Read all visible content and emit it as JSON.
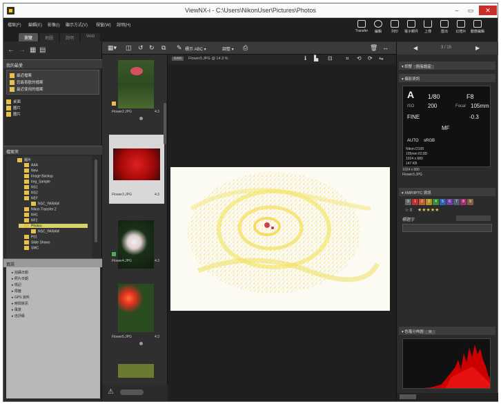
{
  "window": {
    "title": "ViewNX-i - C:\\Users\\NikonUser\\Pictures\\Photos",
    "controls": {
      "minimize": "–",
      "maximize": "▭",
      "close": "✕"
    }
  },
  "menu": [
    "檔案(F)",
    "編輯(E)",
    "影像(I)",
    "顯示方式(V)",
    "視窗(W)",
    "說明(H)"
  ],
  "workspaces": [
    "瀏覽",
    "地圖",
    "說明",
    "Web"
  ],
  "toolbar": [
    "Transfer",
    "編輯",
    "列印",
    "電子郵件",
    "上傳",
    "匯出",
    "幻燈片",
    "動態編輯"
  ],
  "left_panel": {
    "favorites_title": "我的最愛",
    "favorites": [
      "最近檔案",
      "您最喜歡的檔案",
      "最近使用的檔案"
    ],
    "locations": [
      "桌面",
      "圖片",
      "圖片"
    ],
    "tree_title": "檔案夾",
    "tree": [
      {
        "label": "圖片",
        "level": 0
      },
      {
        "label": "AAA",
        "level": 1
      },
      {
        "label": "New",
        "level": 1
      },
      {
        "label": "Image Backup",
        "level": 1
      },
      {
        "label": "Img_Sample",
        "level": 1
      },
      {
        "label": "NS1",
        "level": 1
      },
      {
        "label": "NS2",
        "level": 1
      },
      {
        "label": "NEF",
        "level": 1
      },
      {
        "label": "NSC_PARAM",
        "level": 2
      },
      {
        "label": "Nikon Transfer 2",
        "level": 1
      },
      {
        "label": "NH1",
        "level": 1
      },
      {
        "label": "NF2",
        "level": 1
      },
      {
        "label": "Photos",
        "level": 1,
        "selected": true
      },
      {
        "label": "NSC_PARAM",
        "level": 2
      },
      {
        "label": "P01",
        "level": 1
      },
      {
        "label": "Slide Shows",
        "level": 1
      },
      {
        "label": "SMC",
        "level": 1
      }
    ],
    "meta_title": "資訊",
    "meta_items": [
      "拍攝日期",
      "照片日期",
      "標記",
      "標籤",
      "GPS 資料",
      "時間資訊",
      "風景",
      "自評級"
    ]
  },
  "thumbnails": [
    {
      "name": "Flower2.JPG",
      "ext": "4:3",
      "selected": false
    },
    {
      "name": "Flower3.JPG",
      "ext": "4:3",
      "selected": true
    },
    {
      "name": "Flower4.JPG",
      "ext": "4:3",
      "selected": false
    },
    {
      "name": "Flower5.JPG",
      "ext": "4:3",
      "selected": false
    }
  ],
  "viewer": {
    "toolbar_text": "標示 ABC",
    "toolbar_menu": "調整",
    "info_label": "Flower3.JPG @ 14.3 %"
  },
  "right_panel": {
    "counter": "3 / 15",
    "tab_label": "調整",
    "preset": "所有設定",
    "section_info": "攝影資訊",
    "camera": {
      "mode": "A",
      "shutter": "1/80",
      "aperture": "F8",
      "iso_label": "ISO",
      "iso": "200",
      "focal_label": "Focal",
      "focal": "105mm",
      "quality": "FINE",
      "exposure": "-0.3",
      "focus": "MF",
      "wb": "AUTO",
      "color": "sRGB",
      "model": "Nikon D100",
      "lens": "105mm f/2.8D",
      "dims1": "1024 x 680",
      "size": "147 KB",
      "dims2": "1024 x 680",
      "file": "Flower3.JPG"
    },
    "section_rating": "XMP/IPTC 資訊",
    "labels": [
      "0",
      "1",
      "2",
      "3",
      "4",
      "5",
      "6",
      "7",
      "8",
      "9"
    ],
    "stars_label": "☆ 0",
    "caption_label": "標題字",
    "section_histo": "色階分佈圖",
    "histo_channel": "R"
  },
  "colors": {
    "accent": "#e6c24a",
    "selected_folder": "#d6d16a",
    "close_button": "#c9302c",
    "histogram": "#cc0000"
  }
}
